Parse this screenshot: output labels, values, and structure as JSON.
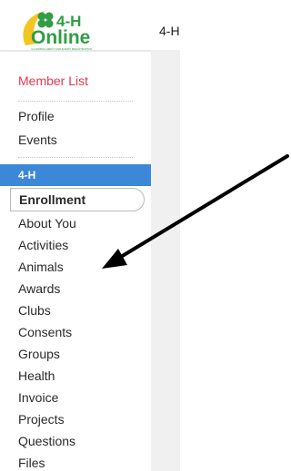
{
  "header": {
    "logo_top": "4-H",
    "logo_bottom": "Online",
    "logo_tagline": "4-H ENROLLMENT AND EVENT REGISTRATION",
    "title": "4-H"
  },
  "sidebar": {
    "member_list": "Member List",
    "top_items": [
      {
        "label": "Profile"
      },
      {
        "label": "Events"
      }
    ],
    "section_title": "4-H",
    "enrollment": "Enrollment",
    "items": [
      {
        "label": "About You"
      },
      {
        "label": "Activities"
      },
      {
        "label": "Animals"
      },
      {
        "label": "Awards"
      },
      {
        "label": "Clubs"
      },
      {
        "label": "Consents"
      },
      {
        "label": "Groups"
      },
      {
        "label": "Health"
      },
      {
        "label": "Invoice"
      },
      {
        "label": "Projects"
      },
      {
        "label": "Questions"
      },
      {
        "label": "Files"
      }
    ]
  },
  "colors": {
    "accent": "#3b88d8",
    "link_red": "#e33a4d",
    "clover_green": "#2f9e44",
    "logo_swoosh": "#f2c521",
    "arrow": "#000000"
  }
}
